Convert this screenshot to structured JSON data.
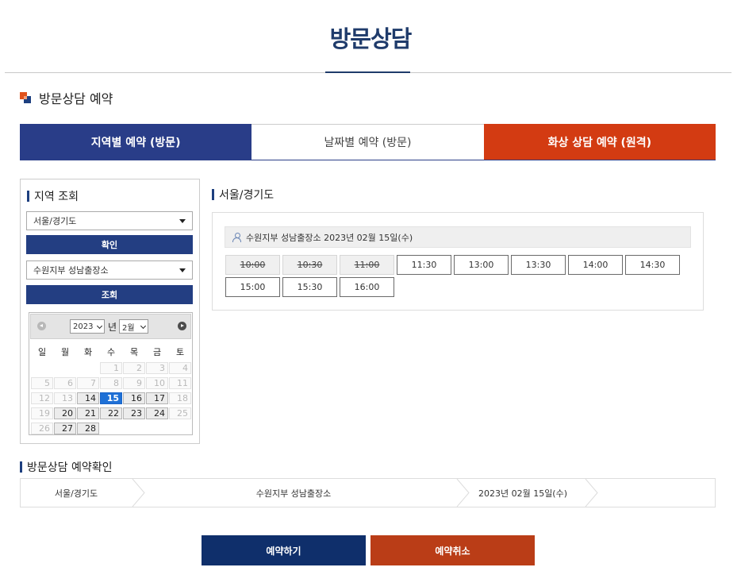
{
  "page": {
    "title": "방문상담",
    "section_title": "방문상담 예약"
  },
  "tabs": [
    {
      "label": "지역별 예약 (방문)",
      "active": true
    },
    {
      "label": "날짜별 예약 (방문)",
      "active": false
    },
    {
      "label": "화상 상담 예약 (원격)",
      "active": false
    }
  ],
  "region_panel": {
    "heading": "지역 조회",
    "region_select": "서울/경기도",
    "confirm_button": "확인",
    "branch_select": "수원지부 성남출장소",
    "search_button": "조회"
  },
  "calendar": {
    "year": "2023",
    "year_suffix": "년",
    "month": "2월",
    "weekdays": [
      "일",
      "월",
      "화",
      "수",
      "목",
      "금",
      "토"
    ],
    "days": [
      {
        "day": "1",
        "state": "dim"
      },
      {
        "day": "2",
        "state": "dim"
      },
      {
        "day": "3",
        "state": "dim"
      },
      {
        "day": "4",
        "state": "dim"
      },
      {
        "day": "5",
        "state": "dim"
      },
      {
        "day": "6",
        "state": "dim"
      },
      {
        "day": "7",
        "state": "dim"
      },
      {
        "day": "8",
        "state": "dim"
      },
      {
        "day": "9",
        "state": "dim"
      },
      {
        "day": "10",
        "state": "dim"
      },
      {
        "day": "11",
        "state": "dim"
      },
      {
        "day": "12",
        "state": "dim"
      },
      {
        "day": "13",
        "state": "dim"
      },
      {
        "day": "14",
        "state": "act"
      },
      {
        "day": "15",
        "state": "sel"
      },
      {
        "day": "16",
        "state": "act"
      },
      {
        "day": "17",
        "state": "act"
      },
      {
        "day": "18",
        "state": "dim"
      },
      {
        "day": "19",
        "state": "dim"
      },
      {
        "day": "20",
        "state": "act"
      },
      {
        "day": "21",
        "state": "act"
      },
      {
        "day": "22",
        "state": "act"
      },
      {
        "day": "23",
        "state": "act"
      },
      {
        "day": "24",
        "state": "act"
      },
      {
        "day": "25",
        "state": "dim"
      },
      {
        "day": "26",
        "state": "dim"
      },
      {
        "day": "27",
        "state": "act"
      },
      {
        "day": "28",
        "state": "act"
      }
    ]
  },
  "slots_panel": {
    "region_heading": "서울/경기도",
    "info": "수원지부 성남출장소 2023년 02월 15일(수)",
    "slots": [
      {
        "time": "10:00",
        "available": false
      },
      {
        "time": "10:30",
        "available": false
      },
      {
        "time": "11:00",
        "available": false
      },
      {
        "time": "11:30",
        "available": true
      },
      {
        "time": "13:00",
        "available": true
      },
      {
        "time": "13:30",
        "available": true
      },
      {
        "time": "14:00",
        "available": true
      },
      {
        "time": "14:30",
        "available": true
      },
      {
        "time": "15:00",
        "available": true
      },
      {
        "time": "15:30",
        "available": true
      },
      {
        "time": "16:00",
        "available": true
      }
    ]
  },
  "confirm": {
    "heading": "방문상담 예약확인",
    "region": "서울/경기도",
    "branch": "수원지부 성남출장소",
    "date": "2023년 02월 15일(수)"
  },
  "actions": {
    "reserve": "예약하기",
    "cancel": "예약취소"
  },
  "colors": {
    "navy": "#293d88",
    "orange": "#d33b12",
    "selected_day": "#1e70d6"
  }
}
